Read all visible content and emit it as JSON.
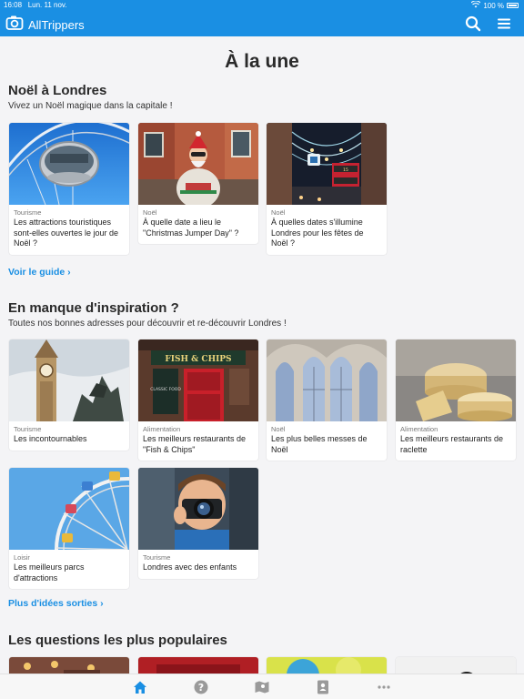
{
  "status": {
    "time": "16:08",
    "date": "Lun. 11 nov.",
    "battery": "100 %"
  },
  "app": {
    "name": "AllTrippers"
  },
  "page": {
    "title": "À la une"
  },
  "section1": {
    "title": "Noël à Londres",
    "subtitle": "Vivez un Noël magique dans la capitale !",
    "link": "Voir le guide",
    "cards": [
      {
        "category": "Tourisme",
        "title": "Les attractions touristiques sont-elles ouvertes le jour de Noël ?"
      },
      {
        "category": "Noël",
        "title": "À quelle date a lieu le \"Christmas Jumper Day\" ?"
      },
      {
        "category": "Noël",
        "title": "À quelles dates s'illumine Londres pour les fêtes de Noël ?"
      }
    ]
  },
  "section2": {
    "title": "En manque d'inspiration ?",
    "subtitle": "Toutes nos bonnes adresses pour découvrir et re-découvrir Londres !",
    "link": "Plus d'idées sorties",
    "cards": [
      {
        "category": "Tourisme",
        "title": "Les incontournables"
      },
      {
        "category": "Alimentation",
        "title": "Les meilleurs restaurants de \"Fish & Chips\""
      },
      {
        "category": "Noël",
        "title": "Les plus belles messes de Noël"
      },
      {
        "category": "Alimentation",
        "title": "Les meilleurs restaurants de raclette"
      },
      {
        "category": "Loisir",
        "title": "Les meilleurs parcs d'attractions"
      },
      {
        "category": "Tourisme",
        "title": "Londres avec des enfants"
      }
    ]
  },
  "section3": {
    "title": "Les questions les plus populaires"
  },
  "images": {
    "fish_sign": "FISH & CHIPS",
    "menu_board": "CLASSIC FOOD",
    "bus_route": "15"
  },
  "tabs": [
    "home-icon",
    "help-icon",
    "map-icon",
    "contacts-icon",
    "more-icon"
  ],
  "colors": {
    "accent": "#1a8fe3",
    "tab_inactive": "#9a9a9a"
  }
}
